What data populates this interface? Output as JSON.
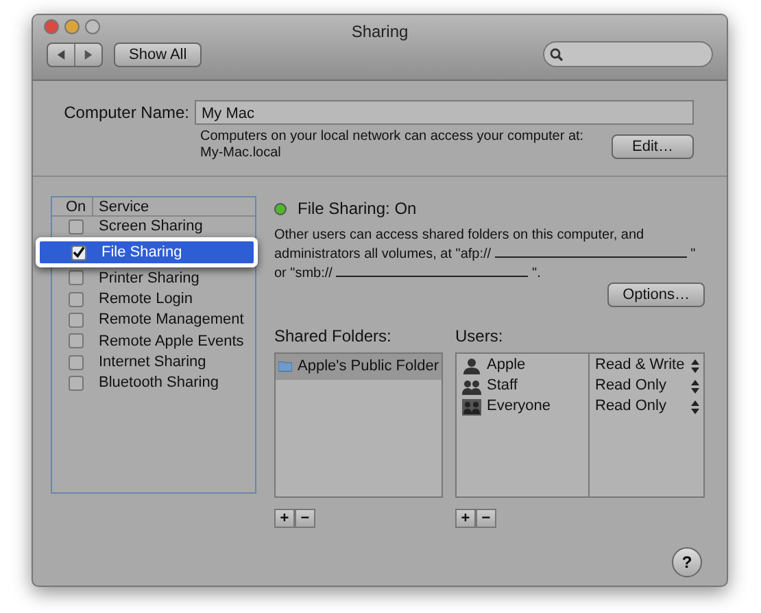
{
  "window": {
    "title": "Sharing"
  },
  "toolbar": {
    "show_all": "Show All"
  },
  "computer_name": {
    "label": "Computer Name:",
    "value": "My Mac",
    "note": "Computers on your local network can access your computer at:",
    "address": "My-Mac.local",
    "button": "Edit…"
  },
  "services": {
    "columns": [
      "On",
      "Service"
    ],
    "items": [
      {
        "name": "Screen Sharing",
        "checked": false,
        "selected": false
      },
      {
        "name": "File Sharing",
        "checked": true,
        "selected": true
      },
      {
        "name": "Printer Sharing",
        "checked": false,
        "selected": false
      },
      {
        "name": "Remote Login",
        "checked": false,
        "selected": false
      },
      {
        "name": "Remote Management",
        "checked": false,
        "selected": false
      },
      {
        "name": "Remote Apple Events",
        "checked": false,
        "selected": false
      },
      {
        "name": "Internet Sharing",
        "checked": false,
        "selected": false
      },
      {
        "name": "Bluetooth Sharing",
        "checked": false,
        "selected": false
      }
    ]
  },
  "status": {
    "label": "File Sharing: On",
    "on": true
  },
  "description": [
    {
      "kind": "text",
      "text": "Other users can access shared folders on this computer, and administrators all volumes, at \"afp://"
    },
    {
      "kind": "blank"
    },
    {
      "kind": "text",
      "text": "\" or \"smb://"
    },
    {
      "kind": "blank"
    },
    {
      "kind": "text",
      "text": "\"."
    }
  ],
  "options_button": "Options…",
  "shared_folders": {
    "heading": "Shared Folders:",
    "items": [
      {
        "name": "Apple's Public Folder",
        "selected": true
      }
    ],
    "add": "+",
    "remove": "−"
  },
  "users": {
    "heading": "Users:",
    "items": [
      {
        "name": "Apple",
        "kind": "user",
        "permission": "Read & Write"
      },
      {
        "name": "Staff",
        "kind": "group",
        "permission": "Read Only"
      },
      {
        "name": "Everyone",
        "kind": "everyone",
        "permission": "Read Only"
      }
    ],
    "add": "+",
    "remove": "−"
  },
  "help": "?"
}
